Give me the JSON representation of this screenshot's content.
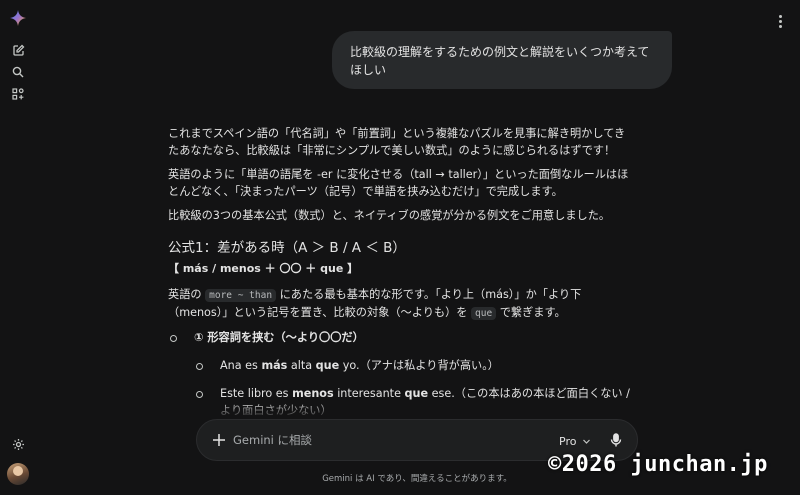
{
  "colors": {
    "background": "#131314",
    "bubble": "#282a2c",
    "composer": "#1e1f20",
    "text": "#e3e3e3"
  },
  "sidebar": {
    "icons": [
      "gemini-spark-icon",
      "new-chat-icon",
      "search-icon",
      "apps-icon",
      "settings-icon"
    ]
  },
  "user_message": "比較級の理解をするための例文と解説をいくつか考えてほしい",
  "response": {
    "intro1": "これまでスペイン語の「代名詞」や「前置詞」という複雑なパズルを見事に解き明かしてきたあなたなら、比較級は「非常にシンプルで美しい数式」のように感じられるはずです！",
    "intro2": "英語のように「単語の語尾を -er に変化させる（tall → taller）」といった面倒なルールはほとんどなく、「決まったパーツ（記号）で単語を挟み込むだけ」で完成します。",
    "intro3": "比較級の3つの基本公式（数式）と、ネイティブの感覚が分かる例文をご用意しました。",
    "section1": {
      "heading": "公式1：差がある時（A ＞ B / A ＜ B）",
      "formula": "【 más / menos ＋ 〇〇 ＋ que 】",
      "desc_before": "英語の ",
      "code1": "more ~ than",
      "desc_mid": " にあたる最も基本的な形です。「より上（más）」か「より下（menos）」という記号を置き、比較の対象（〜よりも）を ",
      "code2": "que",
      "desc_after": " で繋ぎます。",
      "sub_heading": "① 形容詞を挟む（〜より〇〇だ）",
      "ex1": {
        "pre": "Ana es ",
        "b1": "más",
        "mid": " alta ",
        "b2": "que",
        "post": " yo.（アナは私より背が高い。）"
      },
      "ex2": {
        "pre": "Este libro es ",
        "b1": "menos",
        "mid": " interesante ",
        "b2": "que",
        "post": " ese.（この本はあの本ほど面白くない / より面白さが少ない）"
      }
    }
  },
  "composer": {
    "placeholder": "Gemini に相談",
    "mode": "Pro"
  },
  "disclaimer": "Gemini は AI であり、間違えることがあります。",
  "watermark": "©2026 junchan.jp"
}
